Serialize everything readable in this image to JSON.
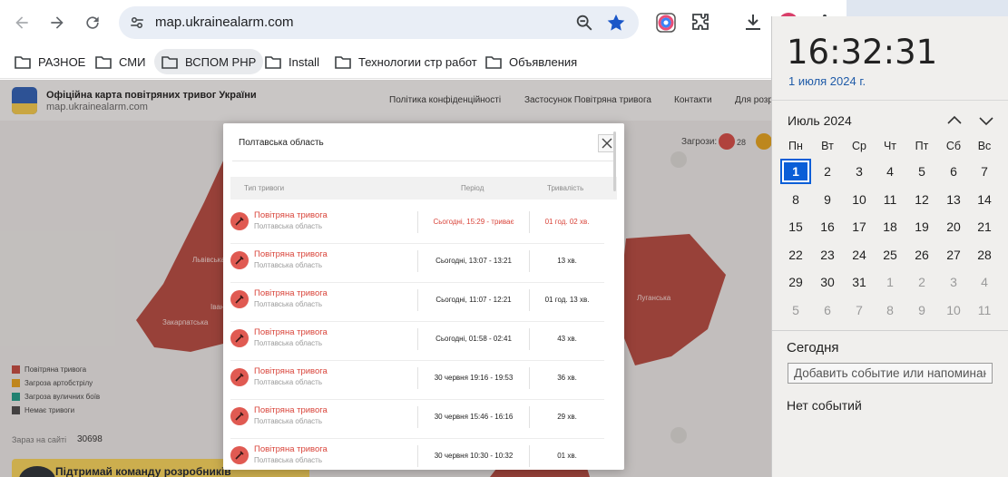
{
  "browser": {
    "url": "map.ukrainealarm.com",
    "profile_initials": "VR",
    "bookmarks": [
      {
        "label": "РАЗНОЕ"
      },
      {
        "label": "СМИ"
      },
      {
        "label": "ВСПОМ РНР"
      },
      {
        "label": "Install"
      },
      {
        "label": "Технологии стр работ"
      },
      {
        "label": "Объявления"
      }
    ]
  },
  "site": {
    "title": "Офіційна карта повітряних тривог України",
    "url": "map.ukrainealarm.com",
    "nav": [
      "Політика конфіденційності",
      "Застосунок Повітряна тривога",
      "Контакти",
      "Для розр"
    ],
    "threats_label": "Загрози:",
    "threat_count": "28",
    "region_labels": [
      "Львівська",
      "Закарпатська",
      "Івано-",
      "Луганська"
    ],
    "legend": [
      {
        "label": "Повітряна тривога",
        "color": "#c24a3f"
      },
      {
        "label": "Загроза артобстрілу",
        "color": "#e5a11c"
      },
      {
        "label": "Загроза вуличних боїв",
        "color": "#1f9a86"
      },
      {
        "label": "Немає тривоги",
        "color": "#4a4a4a"
      }
    ],
    "visits_label": "Зараз на сайті",
    "visits_count": "30698",
    "support_text": "Підтримай команду розробників"
  },
  "modal": {
    "title": "Полтавська область",
    "columns": {
      "type": "Тип тривоги",
      "period": "Період",
      "duration": "Тривалість"
    },
    "rows": [
      {
        "type": "Повітряна тривога",
        "region": "Полтавська область",
        "period": "Сьогодні, 15:29 - триває",
        "duration": "01 год. 02 хв.",
        "active": true
      },
      {
        "type": "Повітряна тривога",
        "region": "Полтавська область",
        "period": "Сьогодні, 13:07 - 13:21",
        "duration": "13 хв.",
        "active": false
      },
      {
        "type": "Повітряна тривога",
        "region": "Полтавська область",
        "period": "Сьогодні, 11:07 - 12:21",
        "duration": "01 год. 13 хв.",
        "active": false
      },
      {
        "type": "Повітряна тривога",
        "region": "Полтавська область",
        "period": "Сьогодні, 01:58 - 02:41",
        "duration": "43 хв.",
        "active": false
      },
      {
        "type": "Повітряна тривога",
        "region": "Полтавська область",
        "period": "30 червня 19:16 - 19:53",
        "duration": "36 хв.",
        "active": false
      },
      {
        "type": "Повітряна тривога",
        "region": "Полтавська область",
        "period": "30 червня 15:46 - 16:16",
        "duration": "29 хв.",
        "active": false
      },
      {
        "type": "Повітряна тривога",
        "region": "Полтавська область",
        "period": "30 червня 10:30 - 10:32",
        "duration": "01 хв.",
        "active": false
      }
    ]
  },
  "flyout": {
    "time": "16:32:31",
    "date": "1 июля 2024 г.",
    "month": "Июль 2024",
    "weekdays": [
      "Пн",
      "Вт",
      "Ср",
      "Чт",
      "Пт",
      "Сб",
      "Вс"
    ],
    "days": [
      [
        "1",
        "2",
        "3",
        "4",
        "5",
        "6",
        "7"
      ],
      [
        "8",
        "9",
        "10",
        "11",
        "12",
        "13",
        "14"
      ],
      [
        "15",
        "16",
        "17",
        "18",
        "19",
        "20",
        "21"
      ],
      [
        "22",
        "23",
        "24",
        "25",
        "26",
        "27",
        "28"
      ],
      [
        "29",
        "30",
        "31",
        "1",
        "2",
        "3",
        "4"
      ],
      [
        "5",
        "6",
        "7",
        "8",
        "9",
        "10",
        "11"
      ]
    ],
    "today_label": "Сегодня",
    "event_placeholder": "Добавить событие или напоминание",
    "no_events": "Нет событий"
  }
}
